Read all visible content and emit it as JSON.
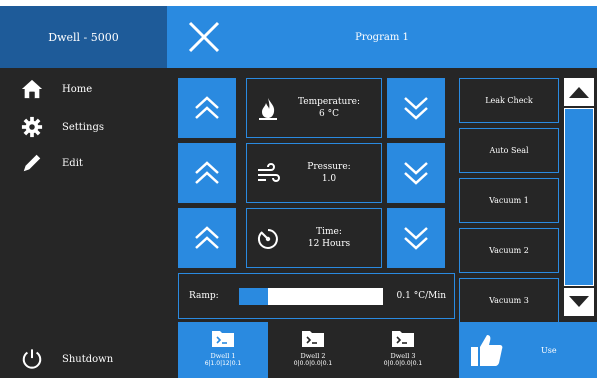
{
  "sidebar": {
    "header": "Dwell - 5000",
    "items": [
      {
        "label": "Home",
        "icon": "home-icon"
      },
      {
        "label": "Settings",
        "icon": "gear-icon"
      },
      {
        "label": "Edit",
        "icon": "pencil-icon"
      }
    ],
    "shutdown": {
      "label": "Shutdown",
      "icon": "power-icon"
    }
  },
  "topbar": {
    "title": "Program 1",
    "close_icon": "close-icon"
  },
  "params": [
    {
      "label": "Temperature:",
      "value": "6 °C",
      "icon": "flame-icon"
    },
    {
      "label": "Pressure:",
      "value": "1.0",
      "icon": "wind-icon"
    },
    {
      "label": "Time:",
      "value": "12 Hours",
      "icon": "timer-icon"
    }
  ],
  "ramp": {
    "label": "Ramp:",
    "value": "0.1 °C/Min",
    "fill_fraction": 0.2
  },
  "list": [
    {
      "label": "Leak Check"
    },
    {
      "label": "Auto Seal"
    },
    {
      "label": "Vacuum 1"
    },
    {
      "label": "Vacuum 2"
    },
    {
      "label": "Vacuum 3"
    }
  ],
  "dwells": [
    {
      "name": "Dwell 1",
      "values": "6|1.0|12|0.1",
      "active": true
    },
    {
      "name": "Dwell 2",
      "values": "0|0.0|0.0|0.1",
      "active": false
    },
    {
      "name": "Dwell 3",
      "values": "0|0.0|0.0|0.1",
      "active": false
    }
  ],
  "use": {
    "label": "Use",
    "icon": "thumbs-up-icon"
  },
  "colors": {
    "accent": "#2a8ae0",
    "panel": "#262626",
    "header": "#1e5b99"
  }
}
